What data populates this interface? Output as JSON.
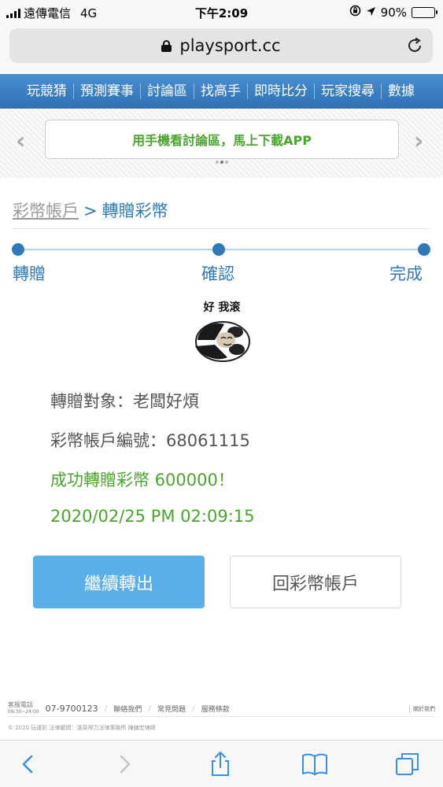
{
  "status_bar": {
    "carrier": "遠傳電信",
    "network": "4G",
    "time": "下午2:09",
    "battery": "90%",
    "battery_level": 0.9
  },
  "browser": {
    "url": "playsport.cc"
  },
  "nav": {
    "items": [
      "玩競猜",
      "預測賽事",
      "討論區",
      "找高手",
      "即時比分",
      "玩家搜尋",
      "數據"
    ]
  },
  "banner": {
    "text": "用手機看討論區，馬上下載APP"
  },
  "breadcrumb": {
    "parent": "彩幣帳戶",
    "separator": ">",
    "current": "轉贈彩幣"
  },
  "steps": [
    "轉贈",
    "確認",
    "完成"
  ],
  "sticker": {
    "caption": "好 我滚"
  },
  "result": {
    "recipient": "轉贈對象：老闆好煩",
    "account": "彩幣帳戶編號：68061115",
    "success": "成功轉贈彩幣 600000！",
    "datetime": "2020/02/25 PM 02:09:15"
  },
  "buttons": {
    "continue": "繼續轉出",
    "back": "回彩幣帳戶"
  },
  "footer": {
    "service_label": "客服電話",
    "service_hours": "09:30~24:00",
    "phone": "07-9700123",
    "links": [
      "聯絡我們",
      "常見問題",
      "服務條款"
    ],
    "about": "關於我們",
    "copyright": "© 2020 玩運彩 法律顧問：漢英得力法律事務所 陳鎮宏律師"
  },
  "colors": {
    "brand_blue": "#2e7ab8",
    "success_green": "#4aa52e",
    "primary_button": "#5aafe8"
  }
}
